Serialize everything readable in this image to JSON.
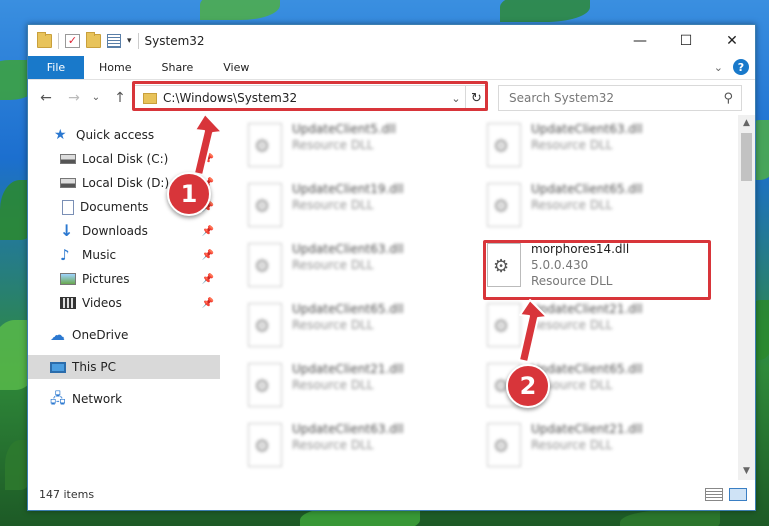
{
  "window": {
    "title": "System32"
  },
  "window_controls": {
    "minimize": "—",
    "maximize": "☐",
    "close": "✕"
  },
  "ribbon": {
    "tabs": [
      "File",
      "Home",
      "Share",
      "View"
    ],
    "help": "?"
  },
  "nav": {
    "back": "←",
    "forward": "→",
    "recent": "⌄",
    "up": "↑"
  },
  "address": {
    "path": "C:\\Windows\\System32",
    "dropdown": "⌄",
    "refresh": "↻"
  },
  "search": {
    "placeholder": "Search System32",
    "icon": "⚲"
  },
  "sidebar": {
    "items": [
      {
        "label": "Quick access",
        "icon": "star-icon"
      },
      {
        "label": "Local Disk (C:)",
        "icon": "disk-icon",
        "pinned": true
      },
      {
        "label": "Local Disk (D:)",
        "icon": "disk-icon",
        "pinned": true
      },
      {
        "label": "Documents",
        "icon": "documents-icon",
        "pinned": true
      },
      {
        "label": "Downloads",
        "icon": "downloads-icon",
        "pinned": true
      },
      {
        "label": "Music",
        "icon": "music-icon",
        "pinned": true
      },
      {
        "label": "Pictures",
        "icon": "pictures-icon",
        "pinned": true
      },
      {
        "label": "Videos",
        "icon": "videos-icon",
        "pinned": true
      },
      {
        "label": "OneDrive",
        "icon": "cloud-icon"
      },
      {
        "label": "This PC",
        "icon": "computer-icon",
        "selected": true
      },
      {
        "label": "Network",
        "icon": "network-icon"
      }
    ]
  },
  "files": [
    {
      "name": "UpdateClient5.dll",
      "sub": "Resource DLL"
    },
    {
      "name": "UpdateClient63.dll",
      "sub": "Resource DLL"
    },
    {
      "name": "UpdateClient19.dll",
      "sub": "Resource DLL"
    },
    {
      "name": "UpdateClient65.dll",
      "sub": "Resource DLL"
    },
    {
      "name": "UpdateClient63.dll",
      "sub": "Resource DLL"
    },
    {
      "name": "morphores14.dll",
      "version": "5.0.0.430",
      "sub": "Resource DLL"
    },
    {
      "name": "UpdateClient65.dll",
      "sub": "Resource DLL"
    },
    {
      "name": "UpdateClient21.dll",
      "sub": "Resource DLL"
    },
    {
      "name": "UpdateClient21.dll",
      "sub": "Resource DLL"
    },
    {
      "name": "UpdateClient65.dll",
      "sub": "Resource DLL"
    },
    {
      "name": "UpdateClient63.dll",
      "sub": "Resource DLL"
    },
    {
      "name": "UpdateClient21.dll",
      "sub": "Resource DLL"
    }
  ],
  "status": {
    "item_count": "147 items"
  },
  "annotations": {
    "badge1": "1",
    "badge2": "2"
  },
  "colors": {
    "accent": "#1979ca",
    "highlight": "#d8353a",
    "selection": "#d9d9d9"
  }
}
